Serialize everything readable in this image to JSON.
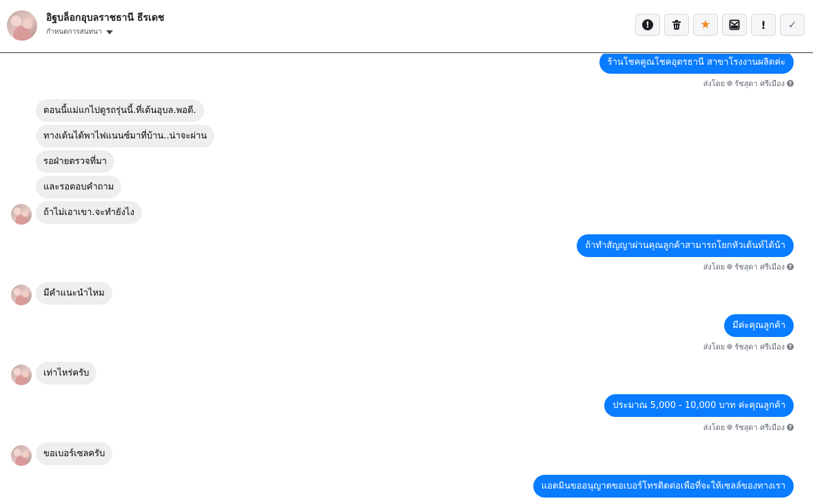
{
  "header": {
    "contact_name": "อิฐบล็อกอุบลราชธานี ธีรเดช",
    "subtitle": "กำหนดการสนทนา",
    "toolbar": {
      "icons": [
        "alert-icon",
        "trash-icon",
        "star-icon",
        "mark-unread-icon",
        "important-icon",
        "check-icon"
      ],
      "bang": "!",
      "check": "✓",
      "star": "★"
    }
  },
  "messages": [
    {
      "dir": "out",
      "text": "ร้านโชคคูณโชคอุดรธานี สาขาโรงงานผลิตค่ะ",
      "sent_by": "ส่งโดย",
      "agent": "รัชสุดา ศรีเมือง"
    },
    {
      "dir": "in",
      "text": "ตอนนี้แม่แกไปดูรถรุ่นนี้.ที่เต้นอุบล.พอดี."
    },
    {
      "dir": "in",
      "text": "ทางเต้นได้พาไฟแนนซ์มาที่บ้าน..น่าจะผ่าน"
    },
    {
      "dir": "in",
      "text": "รอฝ่ายตรวจที่มา"
    },
    {
      "dir": "in",
      "text": "และรอตอบคำถาม"
    },
    {
      "dir": "in",
      "text": "ถ้าไม่เอาเขา.จะทำยังไง"
    },
    {
      "dir": "out",
      "text": "ถ้าทำสัญญาผ่านคุณลูกค้าสามารถโยกหัวเต้นท์ได้น้า",
      "sent_by": "ส่งโดย",
      "agent": "รัชสุดา ศรีเมือง"
    },
    {
      "dir": "in",
      "text": "มีคำแนะนำไหม"
    },
    {
      "dir": "out",
      "text": "มีค่ะคุณลูกค้า",
      "sent_by": "ส่งโดย",
      "agent": "รัชสุดา ศรีเมือง"
    },
    {
      "dir": "in",
      "text": "เท่าไหร่ครับ"
    },
    {
      "dir": "out",
      "text": "ประมาณ 5,000 - 10,000 บาท ค่ะคุณลูกค้า",
      "sent_by": "ส่งโดย",
      "agent": "รัชสุดา ศรีเมือง"
    },
    {
      "dir": "in",
      "text": "ขอเบอร์เซลครับ"
    },
    {
      "dir": "out",
      "text": "แอดมินขออนุญาตขอเบอร์โทรติดต่อเพื่อที่จะให้เซลล์ของทางเรา"
    }
  ],
  "help_glyph": "?",
  "colors": {
    "outgoing": "#0a7cff",
    "incoming": "#eeeeee",
    "accent": "#f28a1e"
  }
}
